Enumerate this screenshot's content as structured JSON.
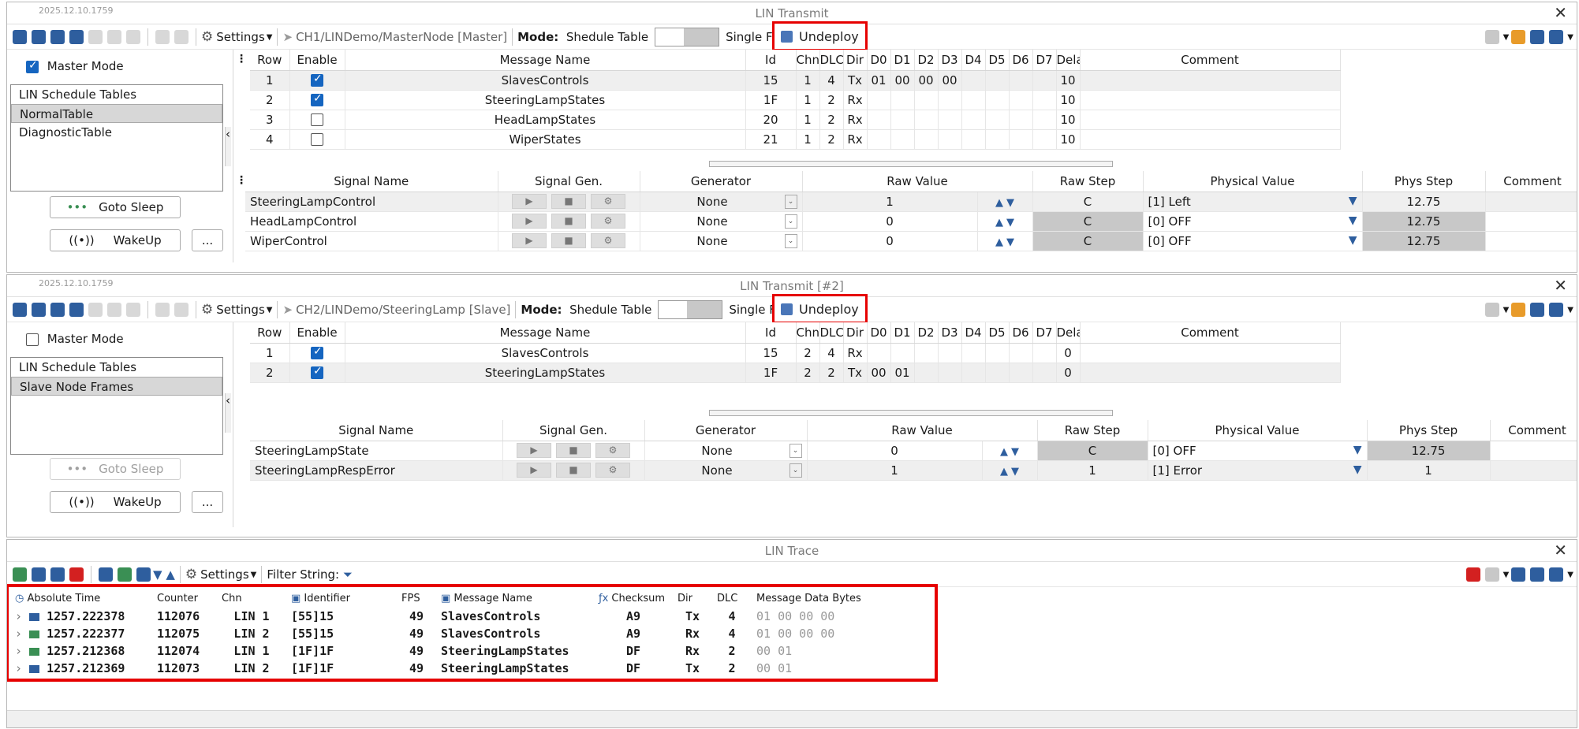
{
  "panel1": {
    "version": "2025.12.10.1759",
    "title": "LIN Transmit",
    "node": "CH1/LINDemo/MasterNode [Master]",
    "master_mode_label": "Master Mode",
    "master_mode_checked": true,
    "list_header": "LIN Schedule Tables",
    "list_items": [
      "NormalTable",
      "DiagnosticTable"
    ],
    "goto_sleep": "Goto Sleep",
    "wakeup": "WakeUp",
    "more": "...",
    "messages": [
      {
        "row": "1",
        "enabled": true,
        "name": "SlavesControls",
        "id": "15",
        "chn": "1",
        "dlc": "4",
        "dir": "Tx",
        "d": [
          "01",
          "00",
          "00",
          "00",
          "",
          "",
          "",
          ""
        ],
        "delay": "10",
        "comment": ""
      },
      {
        "row": "2",
        "enabled": true,
        "name": "SteeringLampStates",
        "id": "1F",
        "chn": "1",
        "dlc": "2",
        "dir": "Rx",
        "d": [
          "",
          "",
          "",
          "",
          "",
          "",
          "",
          ""
        ],
        "delay": "10",
        "comment": ""
      },
      {
        "row": "3",
        "enabled": false,
        "name": "HeadLampStates",
        "id": "20",
        "chn": "1",
        "dlc": "2",
        "dir": "Rx",
        "d": [
          "",
          "",
          "",
          "",
          "",
          "",
          "",
          ""
        ],
        "delay": "10",
        "comment": ""
      },
      {
        "row": "4",
        "enabled": false,
        "name": "WiperStates",
        "id": "21",
        "chn": "1",
        "dlc": "2",
        "dir": "Rx",
        "d": [
          "",
          "",
          "",
          "",
          "",
          "",
          "",
          ""
        ],
        "delay": "10",
        "comment": ""
      }
    ],
    "signals": [
      {
        "name": "SteeringLampControl",
        "generator": "None",
        "raw": "1",
        "raw_step": "C",
        "phys": "[1] Left",
        "phys_step": "12.75",
        "comment": ""
      },
      {
        "name": "HeadLampControl",
        "generator": "None",
        "raw": "0",
        "raw_step": "C",
        "phys": "[0] OFF",
        "phys_step": "12.75",
        "comment": ""
      },
      {
        "name": "WiperControl",
        "generator": "None",
        "raw": "0",
        "raw_step": "C",
        "phys": "[0] OFF",
        "phys_step": "12.75",
        "comment": ""
      }
    ]
  },
  "panel2": {
    "version": "2025.12.10.1759",
    "title": "LIN Transmit [#2]",
    "node": "CH2/LINDemo/SteeringLamp [Slave]",
    "master_mode_label": "Master Mode",
    "master_mode_checked": false,
    "list_header": "LIN Schedule Tables",
    "list_items": [
      "Slave Node Frames"
    ],
    "goto_sleep": "Goto Sleep",
    "wakeup": "WakeUp",
    "more": "...",
    "messages": [
      {
        "row": "1",
        "enabled": true,
        "name": "SlavesControls",
        "id": "15",
        "chn": "2",
        "dlc": "4",
        "dir": "Rx",
        "d": [
          "",
          "",
          "",
          "",
          "",
          "",
          "",
          ""
        ],
        "delay": "0",
        "comment": ""
      },
      {
        "row": "2",
        "enabled": true,
        "name": "SteeringLampStates",
        "id": "1F",
        "chn": "2",
        "dlc": "2",
        "dir": "Tx",
        "d": [
          "00",
          "01",
          "",
          "",
          "",
          "",
          "",
          ""
        ],
        "delay": "0",
        "comment": ""
      }
    ],
    "signals": [
      {
        "name": "SteeringLampState",
        "generator": "None",
        "raw": "0",
        "raw_step": "C",
        "phys": "[0] OFF",
        "phys_step": "12.75",
        "comment": ""
      },
      {
        "name": "SteeringLampRespError",
        "generator": "None",
        "raw": "1",
        "raw_step": "1",
        "phys": "[1] Error",
        "phys_step": "1",
        "comment": ""
      }
    ]
  },
  "toolbar": {
    "settings": "Settings",
    "mode_label": "Mode:",
    "mode_value": "Shedule Table",
    "single_frame": "Single Frame",
    "undeploy": "Undeploy"
  },
  "msg_headers": {
    "row": "Row",
    "enable": "Enable",
    "name": "Message Name",
    "id": "Id",
    "chn": "Chn",
    "dlc": "DLC",
    "dir": "Dir",
    "d": [
      "D0",
      "D1",
      "D2",
      "D3",
      "D4",
      "D5",
      "D6",
      "D7"
    ],
    "delay": "Delay Time (ms)",
    "comment": "Comment"
  },
  "sig_headers": {
    "name": "Signal Name",
    "gen": "Signal Gen.",
    "generator": "Generator",
    "raw": "Raw Value",
    "raw_step": "Raw Step",
    "phys": "Physical Value",
    "phys_step": "Phys Step",
    "comment": "Comment"
  },
  "trace": {
    "title": "LIN Trace",
    "settings": "Settings",
    "filter_label": "Filter String:",
    "headers": {
      "time": "Absolute Time",
      "counter": "Counter",
      "chn": "Chn",
      "identifier": "Identifier",
      "fps": "FPS",
      "msg": "Message Name",
      "checksum": "Checksum",
      "dir": "Dir",
      "dlc": "DLC",
      "bytes": "Message Data Bytes"
    },
    "rows": [
      {
        "time": "1257.222378",
        "counter": "112076",
        "chn": "LIN 1",
        "identifier": "[55]15",
        "fps": "49",
        "msg": "SlavesControls",
        "checksum": "A9",
        "dir": "Tx",
        "dlc": "4",
        "bytes": "01 00 00 00",
        "icon": "blue"
      },
      {
        "time": "1257.222377",
        "counter": "112075",
        "chn": "LIN 2",
        "identifier": "[55]15",
        "fps": "49",
        "msg": "SlavesControls",
        "checksum": "A9",
        "dir": "Rx",
        "dlc": "4",
        "bytes": "01 00 00 00",
        "icon": "green"
      },
      {
        "time": "1257.212368",
        "counter": "112074",
        "chn": "LIN 1",
        "identifier": "[1F]1F",
        "fps": "49",
        "msg": "SteeringLampStates",
        "checksum": "DF",
        "dir": "Rx",
        "dlc": "2",
        "bytes": "00 01",
        "icon": "green"
      },
      {
        "time": "1257.212369",
        "counter": "112073",
        "chn": "LIN 2",
        "identifier": "[1F]1F",
        "fps": "49",
        "msg": "SteeringLampStates",
        "checksum": "DF",
        "dir": "Tx",
        "dlc": "2",
        "bytes": "00 01",
        "icon": "blue"
      }
    ]
  },
  "colors": {
    "accent": "#2e5e9e",
    "highlight": "#e60000",
    "check": "#1565c0"
  }
}
